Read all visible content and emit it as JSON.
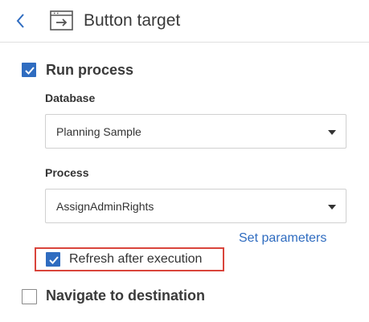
{
  "header": {
    "title": "Button target",
    "back_icon": "chevron-left-icon",
    "title_icon": "window-arrow-icon"
  },
  "run_process": {
    "label": "Run process",
    "checked": true
  },
  "database": {
    "label": "Database",
    "value": "Planning Sample"
  },
  "process": {
    "label": "Process",
    "value": "AssignAdminRights"
  },
  "set_parameters_label": "Set parameters",
  "refresh_after_execution": {
    "label": "Refresh after execution",
    "checked": true
  },
  "navigate_to_destination": {
    "label": "Navigate to destination",
    "checked": false
  },
  "colors": {
    "accent": "#2f6cc0",
    "highlight": "#d9443b",
    "text": "#333333"
  }
}
